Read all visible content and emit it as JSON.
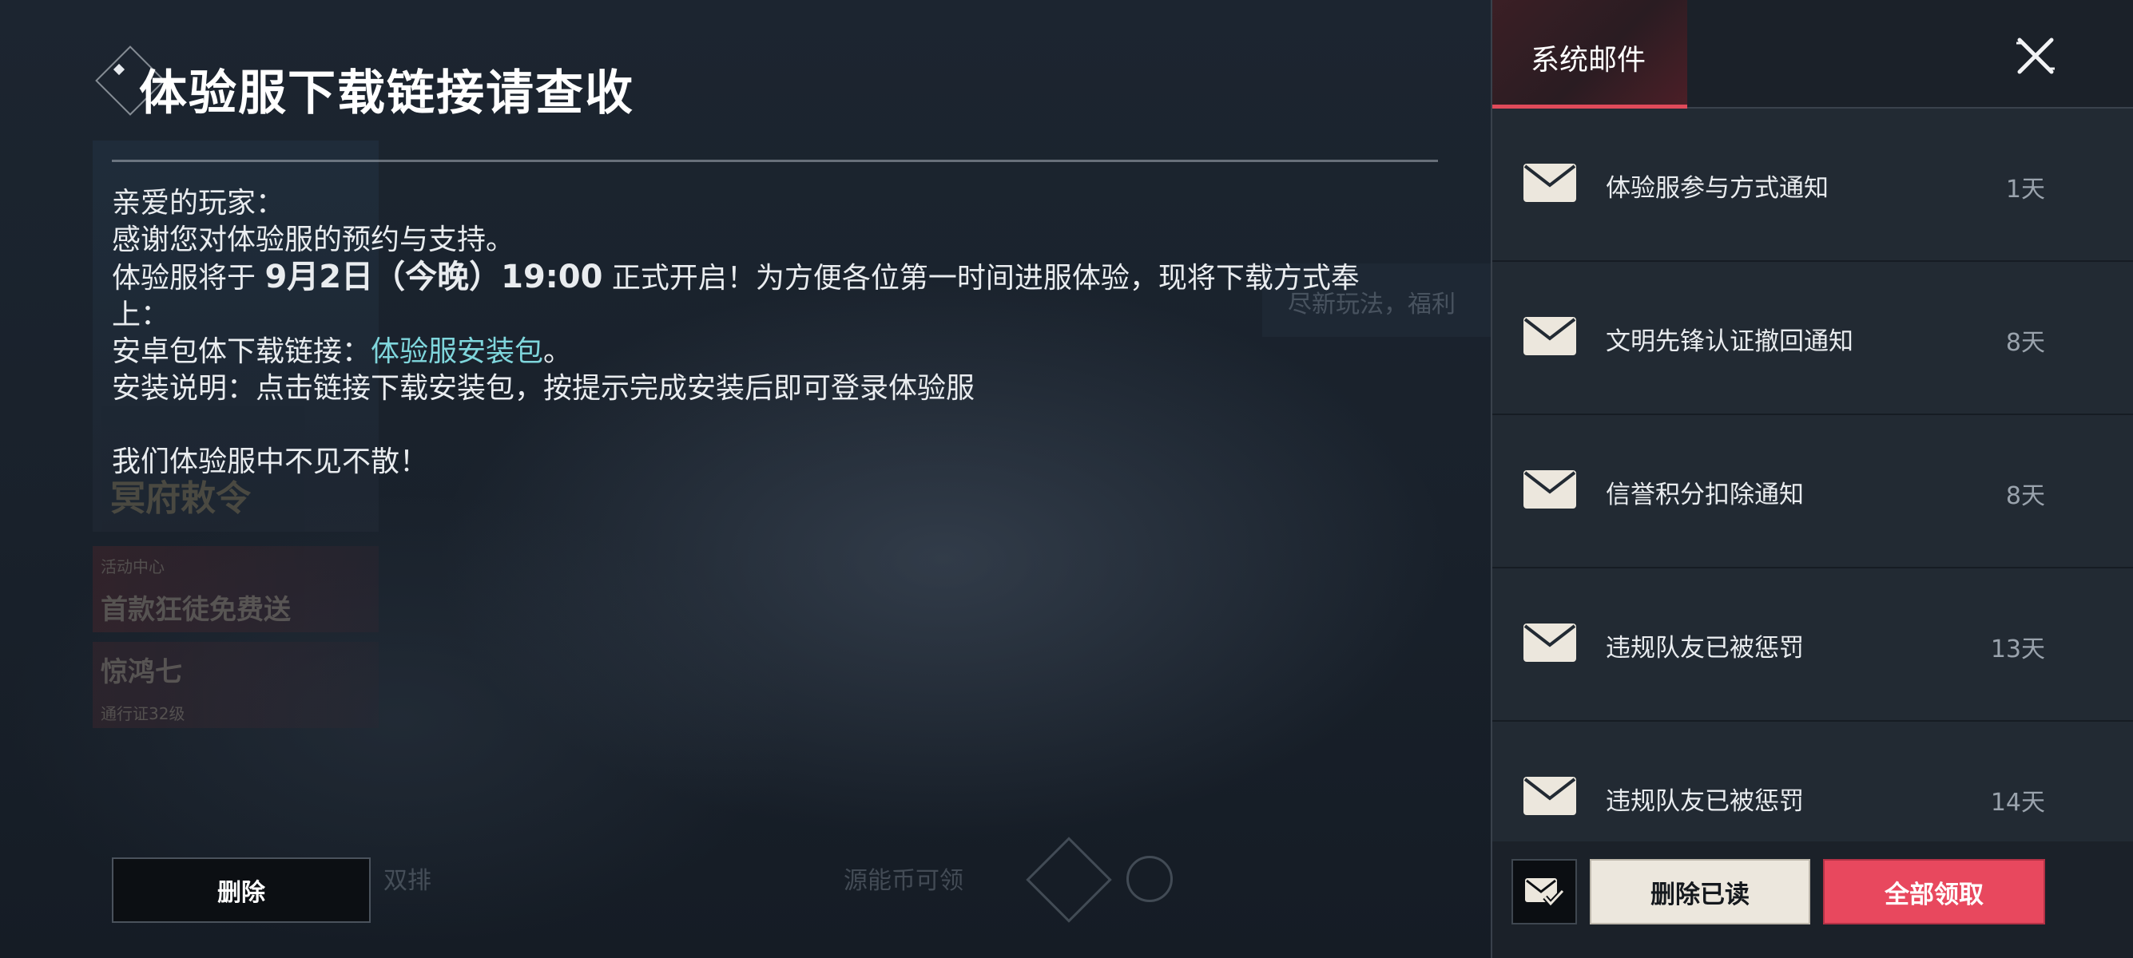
{
  "background": {
    "banner_title": "冥府敕令",
    "card1": {
      "tag": "活动中心",
      "title": "首款狂徒免费送"
    },
    "card2": {
      "tag": "通行证32级",
      "title": "惊鸿七"
    },
    "tip": "尽新玩法，福利",
    "bottom_mode": "双排",
    "bottom_coin": "源能币可领"
  },
  "mail_detail": {
    "title": "体验服下载链接请查收",
    "greeting": "亲爱的玩家：",
    "line_thanks": "感谢您对体验服的预约与支持。",
    "line_open_prefix": "体验服将于",
    "line_open_date": "9月2日（今晚）19:00",
    "line_open_suffix": "正式开启！为方便各位第一时间进服体验，现将下载方式奉",
    "line_open_wrap": "上：",
    "line_android_prefix": "安卓包体下载链接：",
    "line_android_link": "体验服安装包",
    "line_android_suffix": "。",
    "line_install": "安装说明：点击链接下载安装包，按提示完成安装后即可登录体验服",
    "line_bye": "我们体验服中不见不散！",
    "delete_label": "删除"
  },
  "panel": {
    "tab_label": "系统邮件",
    "close_icon": "close-icon",
    "mails": [
      {
        "subject": "体验服参与方式通知",
        "age": "1天"
      },
      {
        "subject": "文明先锋认证撤回通知",
        "age": "8天"
      },
      {
        "subject": "信誉积分扣除通知",
        "age": "8天"
      },
      {
        "subject": "违规队友已被惩罚",
        "age": "13天"
      },
      {
        "subject": "违规队友已被惩罚",
        "age": "14天"
      }
    ],
    "delete_read_label": "删除已读",
    "claim_all_label": "全部领取"
  },
  "colors": {
    "accent_red": "#e8485e",
    "link_cyan": "#7fd6dc"
  }
}
